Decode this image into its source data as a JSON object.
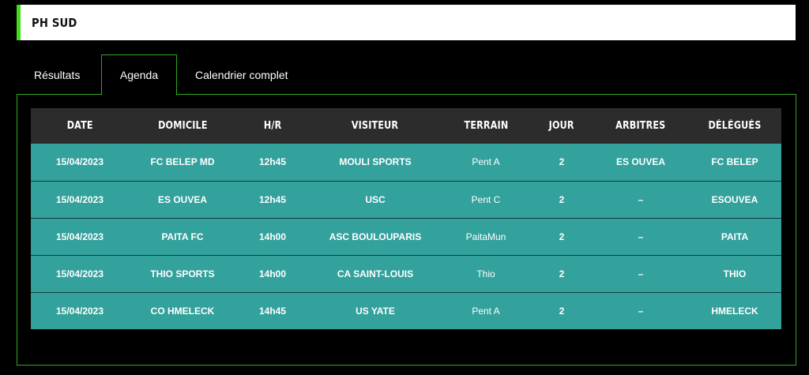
{
  "header": {
    "title": "PH SUD"
  },
  "tabs": [
    {
      "label": "Résultats",
      "active": false
    },
    {
      "label": "Agenda",
      "active": true
    },
    {
      "label": "Calendrier complet",
      "active": false
    }
  ],
  "colors": {
    "accent": "#3fdc19",
    "row_bg": "#33a19c",
    "header_bg": "#2c2c2c",
    "border": "#2ea91e"
  },
  "table": {
    "columns": [
      "DATE",
      "DOMICILE",
      "H/R",
      "VISITEUR",
      "TERRAIN",
      "JOUR",
      "ARBITRES",
      "DÉLÉGUÉS"
    ],
    "rows": [
      [
        "15/04/2023",
        "FC BELEP MD",
        "12h45",
        "MOULI SPORTS",
        "Pent A",
        "2",
        "ES OUVEA",
        "FC BELEP"
      ],
      [
        "15/04/2023",
        "ES OUVEA",
        "12h45",
        "USC",
        "Pent C",
        "2",
        "–",
        "ESOUVEA"
      ],
      [
        "15/04/2023",
        "PAITA FC",
        "14h00",
        "ASC BOULOUPARIS",
        "PaitaMun",
        "2",
        "–",
        "PAITA"
      ],
      [
        "15/04/2023",
        "THIO SPORTS",
        "14h00",
        "CA SAINT-LOUIS",
        "Thio",
        "2",
        "–",
        "THIO"
      ],
      [
        "15/04/2023",
        "CO HMELECK",
        "14h45",
        "US YATE",
        "Pent A",
        "2",
        "–",
        "HMELECK"
      ]
    ]
  }
}
